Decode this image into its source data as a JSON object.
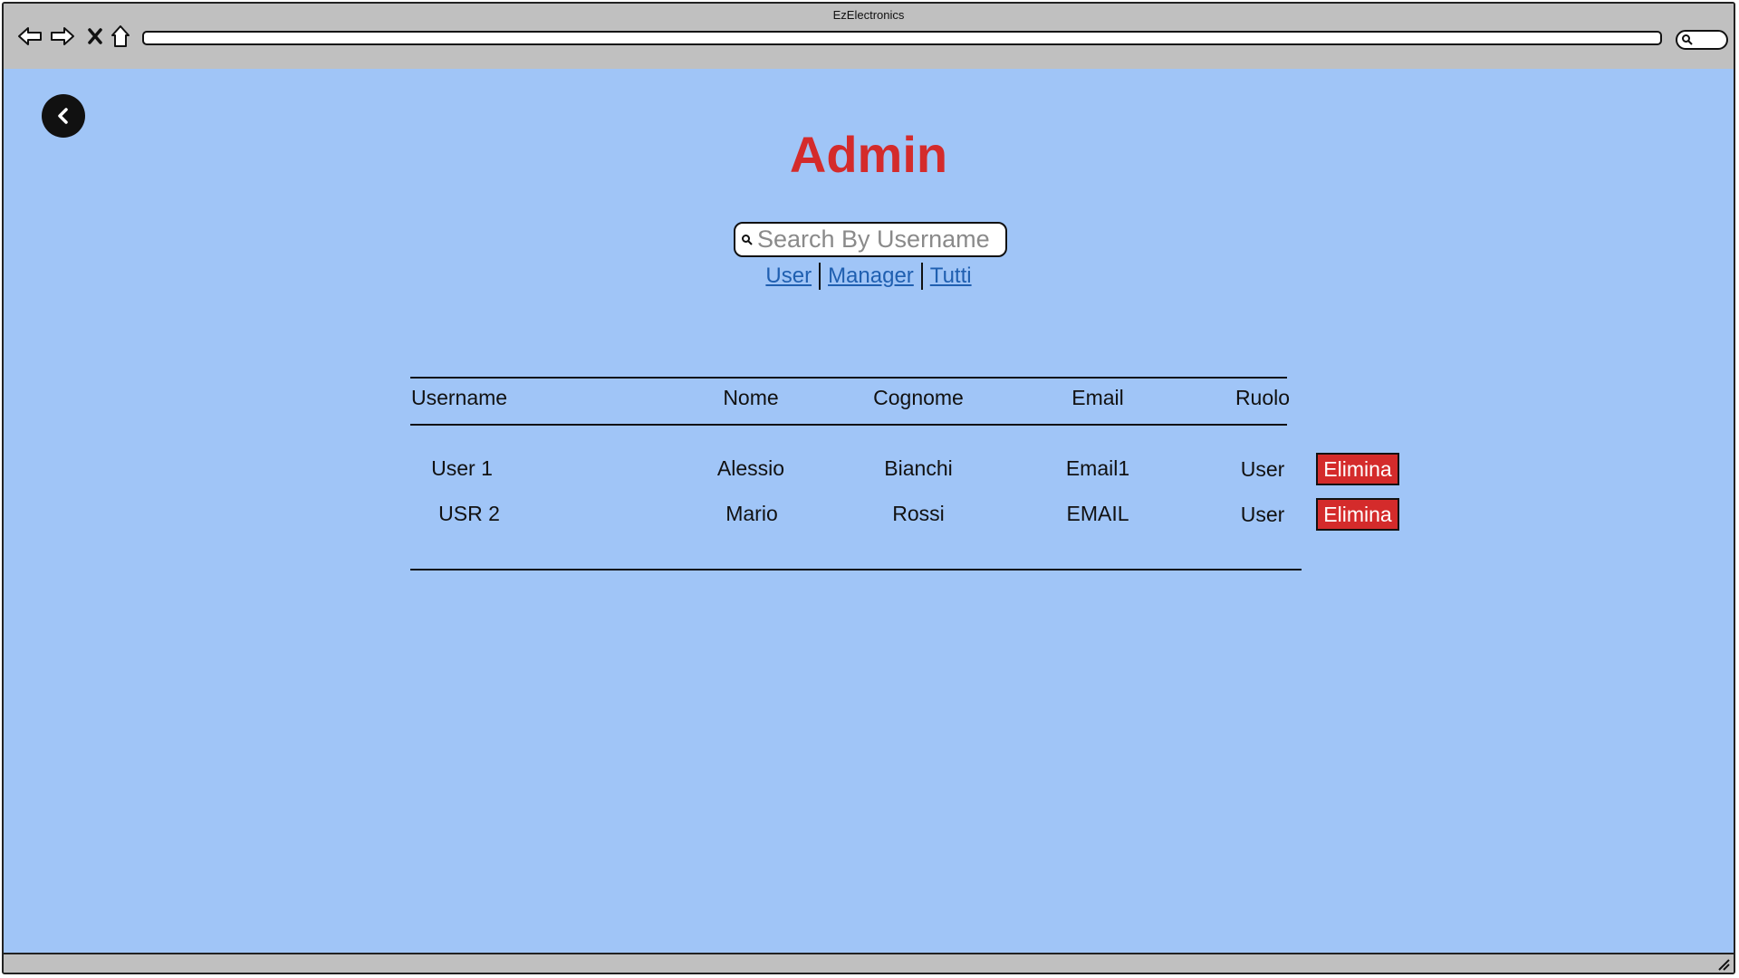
{
  "window": {
    "title": "EzElectronics"
  },
  "icons": {
    "back": "arrow-left-icon",
    "forward": "arrow-right-icon",
    "close": "close-icon",
    "home": "home-icon",
    "search": "search-icon",
    "chevron": "chevron-left-icon"
  },
  "colors": {
    "accent": "#d42b2b",
    "background": "#a0c5f7",
    "link": "#1f5fb0"
  },
  "page": {
    "title": "Admin",
    "search": {
      "placeholder": "Search By Username",
      "value": ""
    },
    "filters": [
      "User",
      "Manager",
      "Tutti"
    ]
  },
  "table": {
    "headers": [
      "Username",
      "Nome",
      "Cognome",
      "Email",
      "Ruolo"
    ],
    "rows": [
      {
        "username": "User 1",
        "nome": "Alessio",
        "cognome": "Bianchi",
        "email": "Email1",
        "ruolo": "User",
        "action": "Elimina"
      },
      {
        "username": "USR 2",
        "nome": "Mario",
        "cognome": "Rossi",
        "email": "EMAIL",
        "ruolo": "User",
        "action": "Elimina"
      }
    ]
  }
}
